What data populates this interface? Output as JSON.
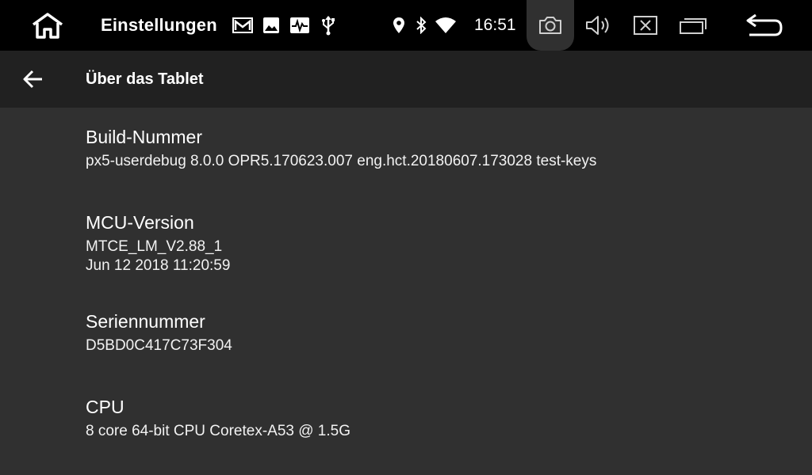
{
  "status_bar": {
    "title": "Einstellungen",
    "time": "16:51",
    "icons": [
      "home-icon",
      "gmail-icon",
      "image-icon",
      "activity-icon",
      "usb-icon",
      "location-icon",
      "bluetooth-icon",
      "wifi-icon",
      "camera-icon",
      "volume-icon",
      "close-window-icon",
      "recent-apps-icon",
      "back-return-icon"
    ]
  },
  "action_bar": {
    "back_icon": "arrow-left-icon",
    "title": "Über das Tablet"
  },
  "preferences": [
    {
      "title": "Build-Nummer",
      "summary": "px5-userdebug 8.0.0 OPR5.170623.007 eng.hct.20180607.173028 test-keys"
    },
    {
      "title": "MCU-Version",
      "summary": "MTCE_LM_V2.88_1\nJun 12 2018 11:20:59"
    },
    {
      "title": "Seriennummer",
      "summary": "D5BD0C417C73F304"
    },
    {
      "title": "CPU",
      "summary": "8 core 64-bit CPU Coretex-A53 @ 1.5G"
    }
  ]
}
